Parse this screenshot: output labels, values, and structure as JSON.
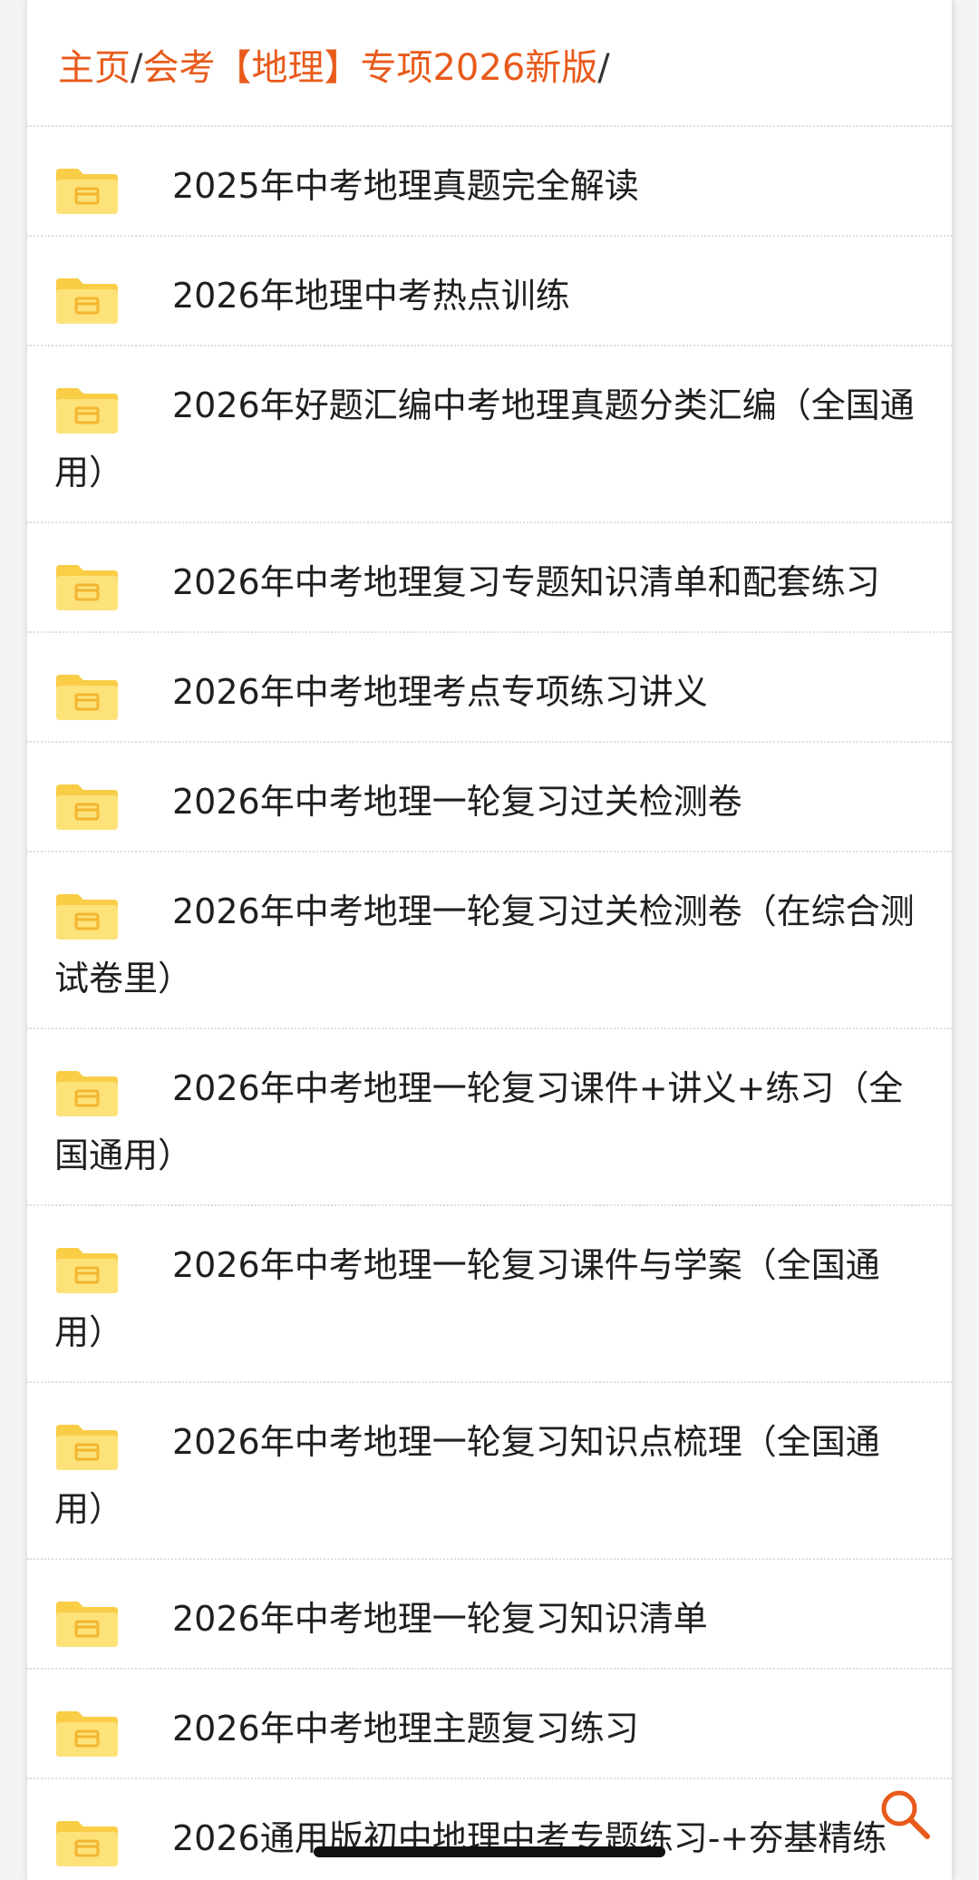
{
  "breadcrumb": {
    "home": "主页",
    "section": "会考【地理】专项2026新版",
    "separator": "/"
  },
  "items": [
    {
      "label": "2025年中考地理真题完全解读"
    },
    {
      "label": "2026年地理中考热点训练"
    },
    {
      "label": "2026年好题汇编中考地理真题分类汇编（全国通用）"
    },
    {
      "label": "2026年中考地理复习专题知识清单和配套练习"
    },
    {
      "label": "2026年中考地理考点专项练习讲义"
    },
    {
      "label": "2026年中考地理一轮复习过关检测卷"
    },
    {
      "label": "2026年中考地理一轮复习过关检测卷（在综合测试卷里）"
    },
    {
      "label": "2026年中考地理一轮复习课件+讲义+练习（全国通用）"
    },
    {
      "label": "2026年中考地理一轮复习课件与学案（全国通用）"
    },
    {
      "label": "2026年中考地理一轮复习知识点梳理（全国通用）"
    },
    {
      "label": "2026年中考地理一轮复习知识清单"
    },
    {
      "label": "2026年中考地理主题复习练习"
    },
    {
      "label": "2026通用版初中地理中考专题练习-+夯基精练"
    }
  ],
  "icons": {
    "folder": "folder-icon",
    "search": "search-icon"
  },
  "colors": {
    "accent": "#e85a1b",
    "folder": "#f9cd46",
    "folder_light": "#fde27a",
    "text": "#1f1f1f"
  }
}
